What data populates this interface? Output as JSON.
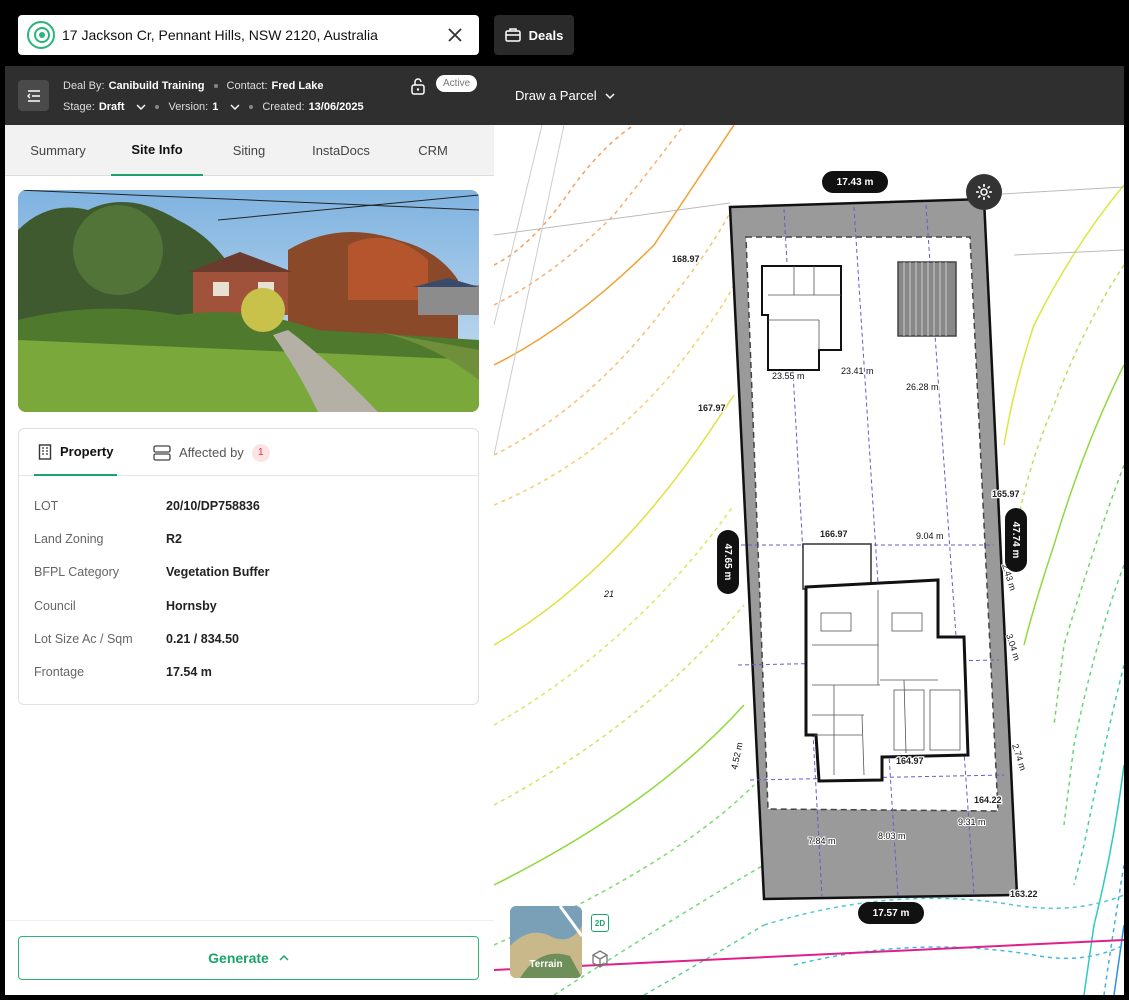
{
  "search": {
    "address": "17 Jackson Cr, Pennant Hills, NSW 2120, Australia"
  },
  "deals_button": {
    "label": "Deals"
  },
  "deal": {
    "deal_by_label": "Deal By:",
    "deal_by": "Canibuild Training",
    "contact_label": "Contact:",
    "contact": "Fred Lake",
    "stage_label": "Stage:",
    "stage": "Draft",
    "version_label": "Version:",
    "version": "1",
    "created_label": "Created:",
    "created": "13/06/2025",
    "status": "Active"
  },
  "tabs": [
    "Summary",
    "Site Info",
    "Siting",
    "InstaDocs",
    "CRM"
  ],
  "active_tab": "Site Info",
  "property_tabs": {
    "property": "Property",
    "affected_by": "Affected by",
    "affected_count": "1"
  },
  "property": [
    {
      "key": "LOT",
      "value": "20/10/DP758836"
    },
    {
      "key": "Land Zoning",
      "value": "R2"
    },
    {
      "key": "BFPL Category",
      "value": "Vegetation Buffer"
    },
    {
      "key": "Council",
      "value": "Hornsby"
    },
    {
      "key": "Lot Size Ac / Sqm",
      "value": "0.21 / 834.50"
    },
    {
      "key": "Frontage",
      "value": "17.54 m"
    }
  ],
  "generate_button": "Generate",
  "map": {
    "draw_parcel": "Draw a Parcel",
    "top_dim": "17.43 m",
    "bottom_dim": "17.57 m",
    "left_dim": "47.65 m",
    "right_dim": "47.74 m",
    "contours": [
      "168.97",
      "167.97",
      "166.97",
      "165.97",
      "164.97",
      "164.22",
      "163.22"
    ],
    "setbacks": [
      "23.55 m",
      "23.41 m",
      "26.28 m",
      "9.04 m",
      "3.04 m",
      "2.74 m",
      "4.52 m",
      "7.84 m",
      "8.03 m",
      "9.31 m",
      "2.43 m"
    ],
    "lot_label": "21",
    "terrain": "Terrain",
    "btn_2d": "2D"
  },
  "colors": {
    "accent": "#1aa36b",
    "header": "#2f2f2f",
    "lot_border": "#111111"
  }
}
